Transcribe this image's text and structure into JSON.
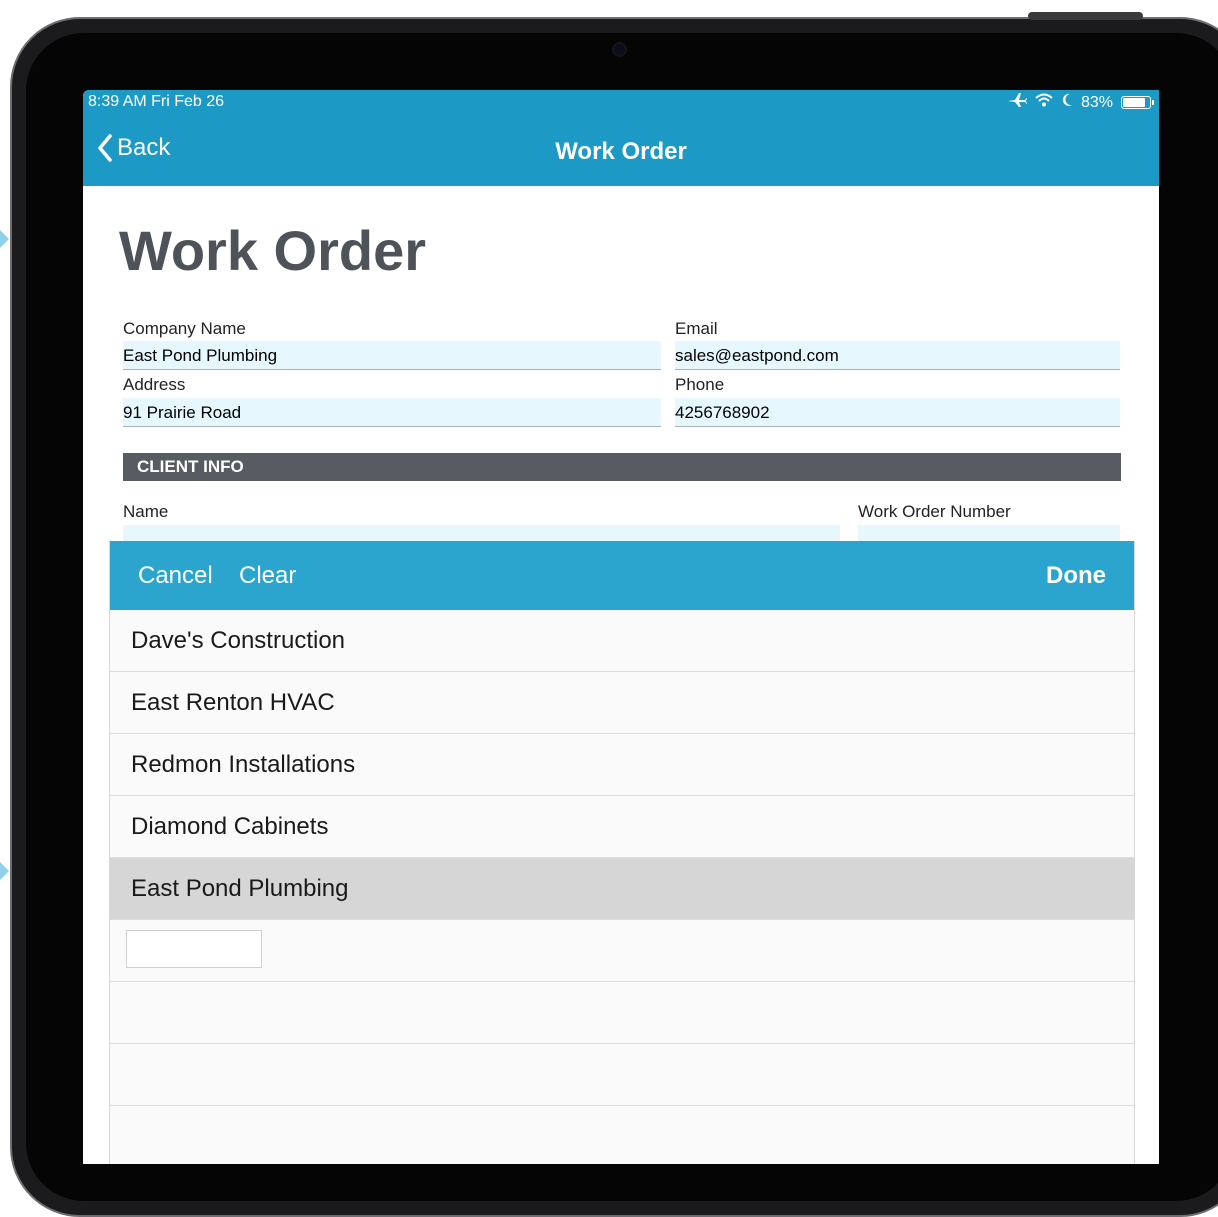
{
  "status_bar": {
    "time_date": "8:39 AM   Fri Feb 26",
    "battery_text": "83%",
    "battery_level": 0.83
  },
  "nav": {
    "back_label": "Back",
    "title": "Work Order"
  },
  "form": {
    "title": "Work Order",
    "company_name": {
      "label": "Company Name",
      "value": "East Pond Plumbing"
    },
    "email": {
      "label": "Email",
      "value": "sales@eastpond.com"
    },
    "address": {
      "label": "Address",
      "value": "91 Prairie Road"
    },
    "phone": {
      "label": "Phone",
      "value": "4256768902"
    },
    "client_section": "CLIENT INFO",
    "client_name": {
      "label": "Name",
      "value": ""
    },
    "work_order_number": {
      "label": "Work Order Number",
      "value": ""
    }
  },
  "picker": {
    "cancel_label": "Cancel",
    "clear_label": "Clear",
    "done_label": "Done",
    "items": [
      {
        "label": "Dave's Construction",
        "selected": false
      },
      {
        "label": "East Renton HVAC",
        "selected": false
      },
      {
        "label": "Redmon Installations",
        "selected": false
      },
      {
        "label": "Diamond Cabinets",
        "selected": false
      },
      {
        "label": "East Pond Plumbing",
        "selected": true
      }
    ]
  },
  "colors": {
    "accent": "#1c9ac5",
    "picker_bar": "#2ba5ce",
    "section_bar": "#565c62",
    "field_bg": "#e6f8fd",
    "selected_row": "#d6d6d6"
  }
}
